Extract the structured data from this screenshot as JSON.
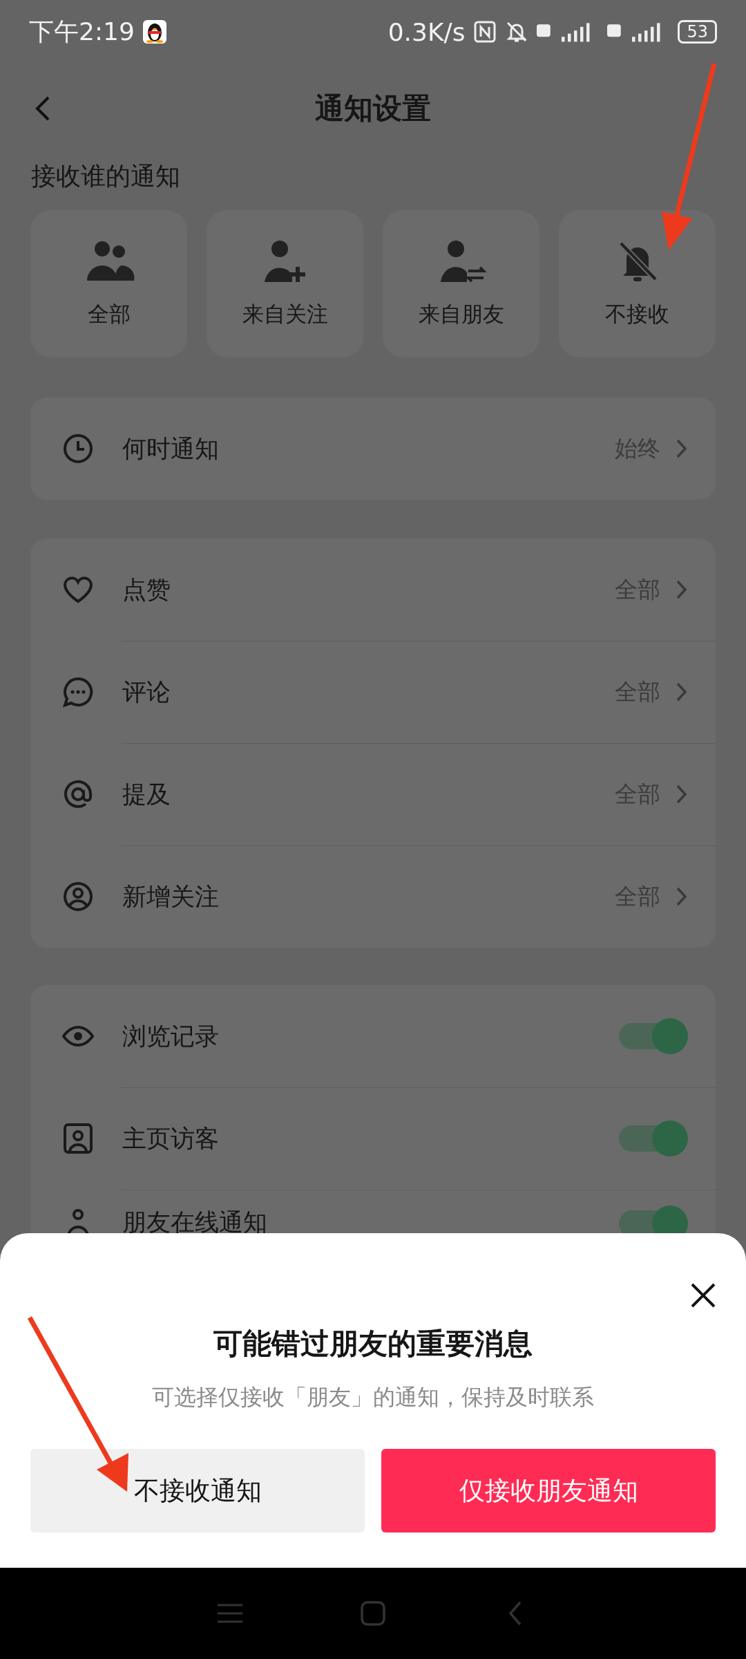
{
  "status_bar": {
    "time": "下午2:19",
    "net_speed": "0.3K/s",
    "battery": "53"
  },
  "header": {
    "title": "通知设置"
  },
  "source_section": {
    "title": "接收谁的通知",
    "options": [
      {
        "label": "全部"
      },
      {
        "label": "来自关注"
      },
      {
        "label": "来自朋友"
      },
      {
        "label": "不接收"
      }
    ]
  },
  "when": {
    "label": "何时通知",
    "value": "始终"
  },
  "interactions": [
    {
      "label": "点赞",
      "value": "全部"
    },
    {
      "label": "评论",
      "value": "全部"
    },
    {
      "label": "提及",
      "value": "全部"
    },
    {
      "label": "新增关注",
      "value": "全部"
    }
  ],
  "toggles": [
    {
      "label": "浏览记录",
      "on": true
    },
    {
      "label": "主页访客",
      "on": true
    },
    {
      "label": "朋友在线通知",
      "on": true
    }
  ],
  "dialog": {
    "title": "可能错过朋友的重要消息",
    "message": "可选择仅接收「朋友」的通知，保持及时联系",
    "buttons": [
      {
        "label": "不接收通知",
        "kind": "secondary"
      },
      {
        "label": "仅接收朋友通知",
        "kind": "primary"
      }
    ]
  }
}
